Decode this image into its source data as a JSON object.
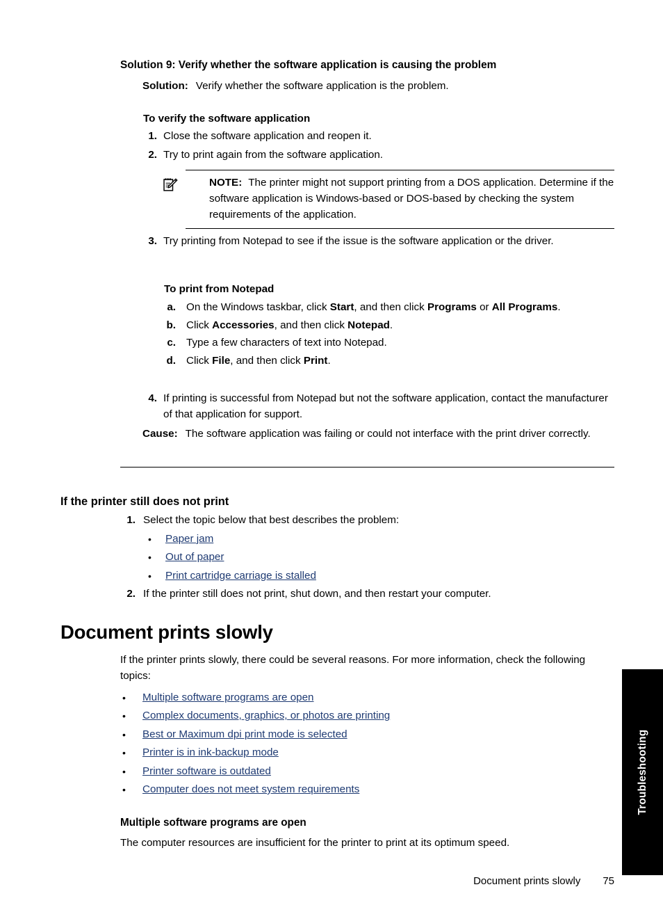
{
  "page": {
    "footer_title": "Document prints slowly",
    "page_number": "75",
    "side_tab_label": "Troubleshooting",
    "link_color": "#1F3B73"
  },
  "solution9": {
    "heading": "Solution 9: Verify whether the software application is causing the problem",
    "solution_label": "Solution:",
    "solution_text": "Verify whether the software application is the problem.",
    "verify_heading": "To verify the software application",
    "steps_1_2": [
      {
        "marker": "1.",
        "text": "Close the software application and reopen it."
      },
      {
        "marker": "2.",
        "text": "Try to print again from the software application."
      }
    ],
    "note": {
      "icon": "note-pencil-icon",
      "label": "NOTE:",
      "text": "The printer might not support printing from a DOS application. Determine if the software application is Windows-based or DOS-based by checking the system requirements of the application."
    },
    "step_3": {
      "marker": "3.",
      "text": "Try printing from Notepad to see if the issue is the software application or the driver."
    },
    "notepad_heading": "To print from Notepad",
    "notepad_steps": [
      {
        "marker": "a.",
        "parts": [
          {
            "text": "On the Windows taskbar, click ",
            "bold": false
          },
          {
            "text": "Start",
            "bold": true
          },
          {
            "text": ", and then click ",
            "bold": false
          },
          {
            "text": "Programs",
            "bold": true
          },
          {
            "text": " or ",
            "bold": false
          },
          {
            "text": "All Programs",
            "bold": true
          },
          {
            "text": ".",
            "bold": false
          }
        ]
      },
      {
        "marker": "b.",
        "parts": [
          {
            "text": "Click ",
            "bold": false
          },
          {
            "text": "Accessories",
            "bold": true
          },
          {
            "text": ", and then click ",
            "bold": false
          },
          {
            "text": "Notepad",
            "bold": true
          },
          {
            "text": ".",
            "bold": false
          }
        ]
      },
      {
        "marker": "c.",
        "parts": [
          {
            "text": "Type a few characters of text into Notepad.",
            "bold": false
          }
        ]
      },
      {
        "marker": "d.",
        "parts": [
          {
            "text": "Click ",
            "bold": false
          },
          {
            "text": "File",
            "bold": true
          },
          {
            "text": ", and then click ",
            "bold": false
          },
          {
            "text": "Print",
            "bold": true
          },
          {
            "text": ".",
            "bold": false
          }
        ]
      }
    ],
    "step_4": {
      "marker": "4.",
      "text": "If printing is successful from Notepad but not the software application, contact the manufacturer of that application for support."
    },
    "cause_label": "Cause:",
    "cause_text": "The software application was failing or could not interface with the print driver correctly."
  },
  "still_not_print": {
    "heading": "If the printer still does not print",
    "step_1_marker": "1.",
    "step_1_text": "Select the topic below that best describes the problem:",
    "links": [
      "Paper jam",
      "Out of paper",
      "Print cartridge carriage is stalled"
    ],
    "step_2_marker": "2.",
    "step_2_text": "If the printer still does not print, shut down, and then restart your computer."
  },
  "document_prints_slowly": {
    "heading": "Document prints slowly",
    "intro": "If the printer prints slowly, there could be several reasons. For more information, check the following topics:",
    "links": [
      "Multiple software programs are open",
      "Complex documents, graphics, or photos are printing",
      "Best or Maximum dpi print mode is selected",
      "Printer is in ink-backup mode",
      "Printer software is outdated",
      "Computer does not meet system requirements"
    ],
    "subsection": {
      "heading": "Multiple software programs are open",
      "paragraph": "The computer resources are insufficient for the printer to print at its optimum speed."
    }
  }
}
